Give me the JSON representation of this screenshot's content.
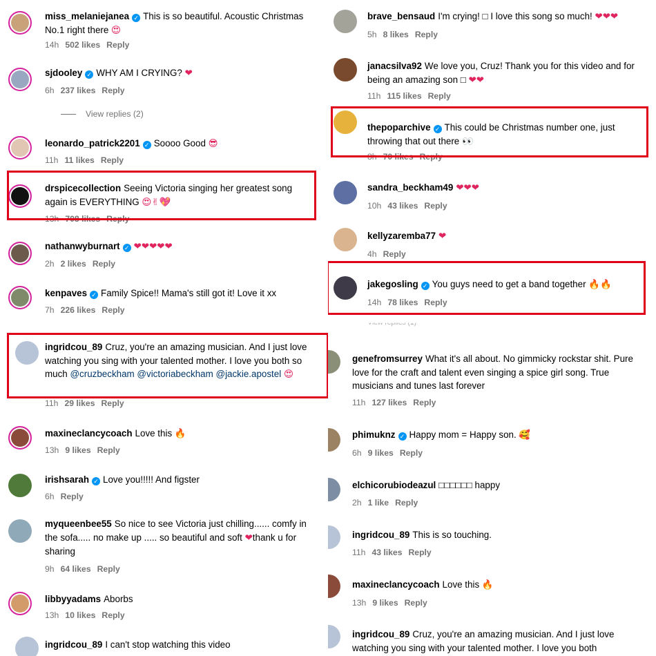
{
  "left": {
    "comments": [
      {
        "user": "miss_melaniejanea",
        "verified": true,
        "text": "This is so beautiful. Acoustic Christmas No.1 right there",
        "emoji": "😍",
        "time": "14h",
        "likes": "502 likes",
        "reply": "Reply",
        "color": "#c9a27a"
      },
      {
        "user": "sjdooley",
        "verified": true,
        "text": "WHY AM I CRYING?",
        "emoji": "❤",
        "time": "6h",
        "likes": "237 likes",
        "reply": "Reply",
        "color": "#9aa7c0"
      },
      {
        "user": "leonardo_patrick2201",
        "verified": true,
        "text": "Soooo Good",
        "emoji": "😎",
        "time": "11h",
        "likes": "11 likes",
        "reply": "Reply",
        "color": "#e0c6b3"
      },
      {
        "user": "drspicecollection",
        "verified": false,
        "text": "Seeing Victoria singing her greatest song again is EVERYTHING",
        "emoji": "😍✌💖",
        "time": "13h",
        "likes": "708 likes",
        "reply": "Reply",
        "color": "#111111"
      },
      {
        "user": "nathanwyburnart",
        "verified": true,
        "text": "",
        "emoji": "❤❤❤❤❤",
        "time": "2h",
        "likes": "2 likes",
        "reply": "Reply",
        "color": "#6c5a4d"
      },
      {
        "user": "kenpaves",
        "verified": true,
        "text": "Family Spice!! Mama's still got it! Love it xx",
        "emoji": "",
        "time": "7h",
        "likes": "226 likes",
        "reply": "Reply",
        "color": "#7f8a6b"
      },
      {
        "user": "ingridcou_89",
        "verified": false,
        "text": "Cruz, you're an amazing musician. And I just love watching you sing with your talented mother. I love you both so much",
        "mentions": "@cruzbeckham @victoriabeckham @jackie.apostel",
        "emoji": "😍",
        "time": "11h",
        "likes": "29 likes",
        "reply": "Reply",
        "color": "#b7c3d6"
      },
      {
        "user": "maxineclancycoach",
        "verified": false,
        "text": "Love this",
        "emoji": "🔥",
        "time": "13h",
        "likes": "9 likes",
        "reply": "Reply",
        "color": "#8a4b3a"
      },
      {
        "user": "irishsarah",
        "verified": true,
        "text": "Love you!!!!! And figster",
        "emoji": "",
        "time": "6h",
        "likes": "",
        "reply": "Reply",
        "color": "#4f7a3a"
      },
      {
        "user": "myqueenbee55",
        "verified": false,
        "text": "So nice to see Victoria just chilling...... comfy in the sofa..... no make up ..... so beautiful and soft",
        "emoji": "❤",
        "text2": "thank u for sharing",
        "time": "9h",
        "likes": "64 likes",
        "reply": "Reply",
        "color": "#8fa9b8"
      },
      {
        "user": "libbyyadams",
        "verified": false,
        "text": "Aborbs",
        "emoji": "",
        "time": "13h",
        "likes": "10 likes",
        "reply": "Reply",
        "color": "#d39b6a"
      },
      {
        "user": "ingridcou_89",
        "verified": false,
        "text": "I can't stop watching this video",
        "emoji": "",
        "time": "",
        "likes": "",
        "reply": "",
        "color": "#b7c3d6"
      }
    ],
    "view_replies": "View replies (2)"
  },
  "right": {
    "comments": [
      {
        "user": "brave_bensaud",
        "verified": false,
        "text": "I'm crying! □ I love this song so much!",
        "emoji": "❤❤❤",
        "time": "5h",
        "likes": "8 likes",
        "reply": "Reply",
        "color": "#a3a39a"
      },
      {
        "user": "janacsilva92",
        "verified": false,
        "text": "We love you, Cruz! Thank you for this video and for being an amazing son □",
        "emoji": "❤❤",
        "time": "11h",
        "likes": "115 likes",
        "reply": "Reply",
        "color": "#7a4a2e"
      },
      {
        "user": "thepoparchive",
        "verified": true,
        "text": "This could be Christmas number one, just throwing that out there",
        "emoji": "👀",
        "time": "8h",
        "likes": "70 likes",
        "reply": "Reply",
        "color": "#e6b23c"
      },
      {
        "user": "sandra_beckham49",
        "verified": false,
        "text": "",
        "emoji": "❤❤❤",
        "time": "10h",
        "likes": "43 likes",
        "reply": "Reply",
        "color": "#5d6fa3"
      },
      {
        "user": "kellyzaremba77",
        "verified": false,
        "text": "",
        "emoji": "❤",
        "time": "4h",
        "likes": "",
        "reply": "Reply",
        "color": "#d9b48f"
      },
      {
        "user": "jakegosling",
        "verified": true,
        "text": "You guys need to get a band together",
        "emoji": "🔥🔥",
        "time": "14h",
        "likes": "78 likes",
        "reply": "Reply",
        "color": "#3f3a48"
      },
      {
        "user": "genefromsurrey",
        "verified": false,
        "text": "What it's all about. No gimmicky rockstar shit. Pure love for the craft and talent even singing a spice girl song. True musicians and tunes last forever",
        "emoji": "",
        "time": "11h",
        "likes": "127 likes",
        "reply": "Reply",
        "color": "#8a9077"
      },
      {
        "user": "phimuknz",
        "verified": true,
        "text": "Happy mom = Happy son.",
        "emoji": "🥰",
        "time": "6h",
        "likes": "9 likes",
        "reply": "Reply",
        "color": "#9b8262"
      },
      {
        "user": "elchicorubiodeazul",
        "verified": false,
        "text": "□□□□□□ happy",
        "emoji": "",
        "time": "2h",
        "likes": "1 like",
        "reply": "Reply",
        "color": "#7d8da3"
      },
      {
        "user": "ingridcou_89",
        "verified": false,
        "text": "This is so touching.",
        "emoji": "",
        "time": "11h",
        "likes": "43 likes",
        "reply": "Reply",
        "color": "#b7c3d6"
      },
      {
        "user": "maxineclancycoach",
        "verified": false,
        "text": "Love this",
        "emoji": "🔥",
        "time": "13h",
        "likes": "9 likes",
        "reply": "Reply",
        "color": "#8a4b3a"
      },
      {
        "user": "ingridcou_89",
        "verified": false,
        "text": "Cruz, you're an amazing musician. And I just love watching you sing with your talented mother. I love you both",
        "emoji": "",
        "time": "",
        "likes": "",
        "reply": "",
        "color": "#b7c3d6"
      }
    ],
    "ghost_text": "View replies (1)"
  },
  "colors": {
    "highlight": "#e0001a",
    "verified": "#0095f6",
    "meta": "#737373",
    "mention": "#00376b"
  }
}
